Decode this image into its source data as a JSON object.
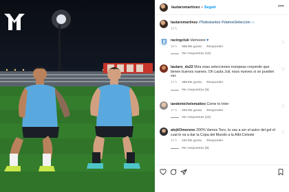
{
  "post": {
    "author": "lautaromartinez",
    "follow_label": "Seguir",
    "dot": "•",
    "more": "•••",
    "caption": {
      "username": "lautaromartinez",
      "text": "#Todosiuntos #VamosSeleccion",
      "time": "17 h"
    }
  },
  "comments": [
    {
      "username": "racingclub",
      "text": "Vamoooo",
      "time": "16 h",
      "likes": "658 Me gusta",
      "reply": "Responder",
      "view_replies": "Ver respuestas (10)"
    },
    {
      "username": "lautaro_ds22",
      "text": "Mira esas selecciones europeas creyendo que tienen buenos nueves. Oh Lauta Juli, esos nueves sí se pueden ver.",
      "time": "17 h",
      "likes": "488 Me gusta",
      "reply": "Responder",
      "view_replies": "Ver respuestas (5)"
    },
    {
      "username": "iandemichelematteo",
      "text": "Come to Inter",
      "time": "17 h",
      "likes": "206 Me gusta",
      "reply": "Responder",
      "view_replies": "Ver respuestas (10)"
    },
    {
      "username": "alejitOmoreno",
      "text": "200% Vamos Toro, tu vas a ser el autor del gol el cual le va a dar la Copa del Mundo a la Albi-Celeste",
      "time": "17 h",
      "likes": "153 Me gusta",
      "reply": "Responder",
      "view_replies": "Ver respuestas (6)"
    }
  ],
  "icons": {
    "logo": "mt-logo-icon",
    "heart": "heart-icon",
    "comment": "comment-icon",
    "share": "share-icon",
    "save": "bookmark-icon"
  },
  "colors": {
    "link": "#0095f6",
    "meta": "#8e8e8e",
    "jersey": "#5aa9de"
  }
}
